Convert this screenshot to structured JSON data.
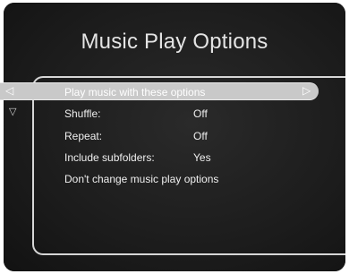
{
  "window": {
    "title": "Music Play Options"
  },
  "icons": {
    "left": "◁",
    "right": "▷",
    "down": "▽"
  },
  "menu": {
    "items": [
      {
        "label": "Play music with these options",
        "value": ""
      },
      {
        "label": "Shuffle:",
        "value": "Off"
      },
      {
        "label": "Repeat:",
        "value": "Off"
      },
      {
        "label": "Include subfolders:",
        "value": "Yes"
      },
      {
        "label": "Don't change music play options",
        "value": ""
      }
    ]
  }
}
